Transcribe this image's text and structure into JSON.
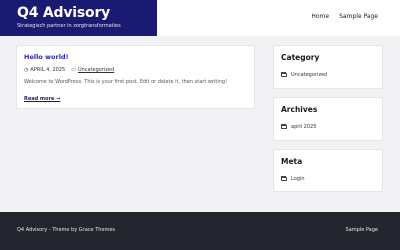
{
  "site": {
    "title": "Q4 Advisory",
    "tagline": "Strategisch partner in zorgtransformaties",
    "brand_color": "#1b1a73"
  },
  "nav": {
    "items": [
      {
        "label": "Home"
      },
      {
        "label": "Sample Page"
      }
    ]
  },
  "post": {
    "title": "Hello world!",
    "date_icon": "clock-icon",
    "date": "APRIL 4, 2025",
    "category_icon": "folder-icon",
    "category": "Uncategorized",
    "excerpt": "Welcome to WordPress. This is your first post. Edit or delete it, then start writing!",
    "read_more": "Read more →"
  },
  "sidebar": {
    "category": {
      "heading": "Category",
      "items": [
        {
          "label": "Uncategorized"
        }
      ]
    },
    "archives": {
      "heading": "Archives",
      "items": [
        {
          "label": "april 2025"
        }
      ]
    },
    "meta": {
      "heading": "Meta",
      "items": [
        {
          "label": "Login"
        }
      ]
    }
  },
  "footer": {
    "credit": "Q4 Advisory - Theme by Grace Themes",
    "nav": [
      {
        "label": "Home"
      },
      {
        "label": "Sample Page"
      }
    ],
    "background": "#23262f"
  }
}
